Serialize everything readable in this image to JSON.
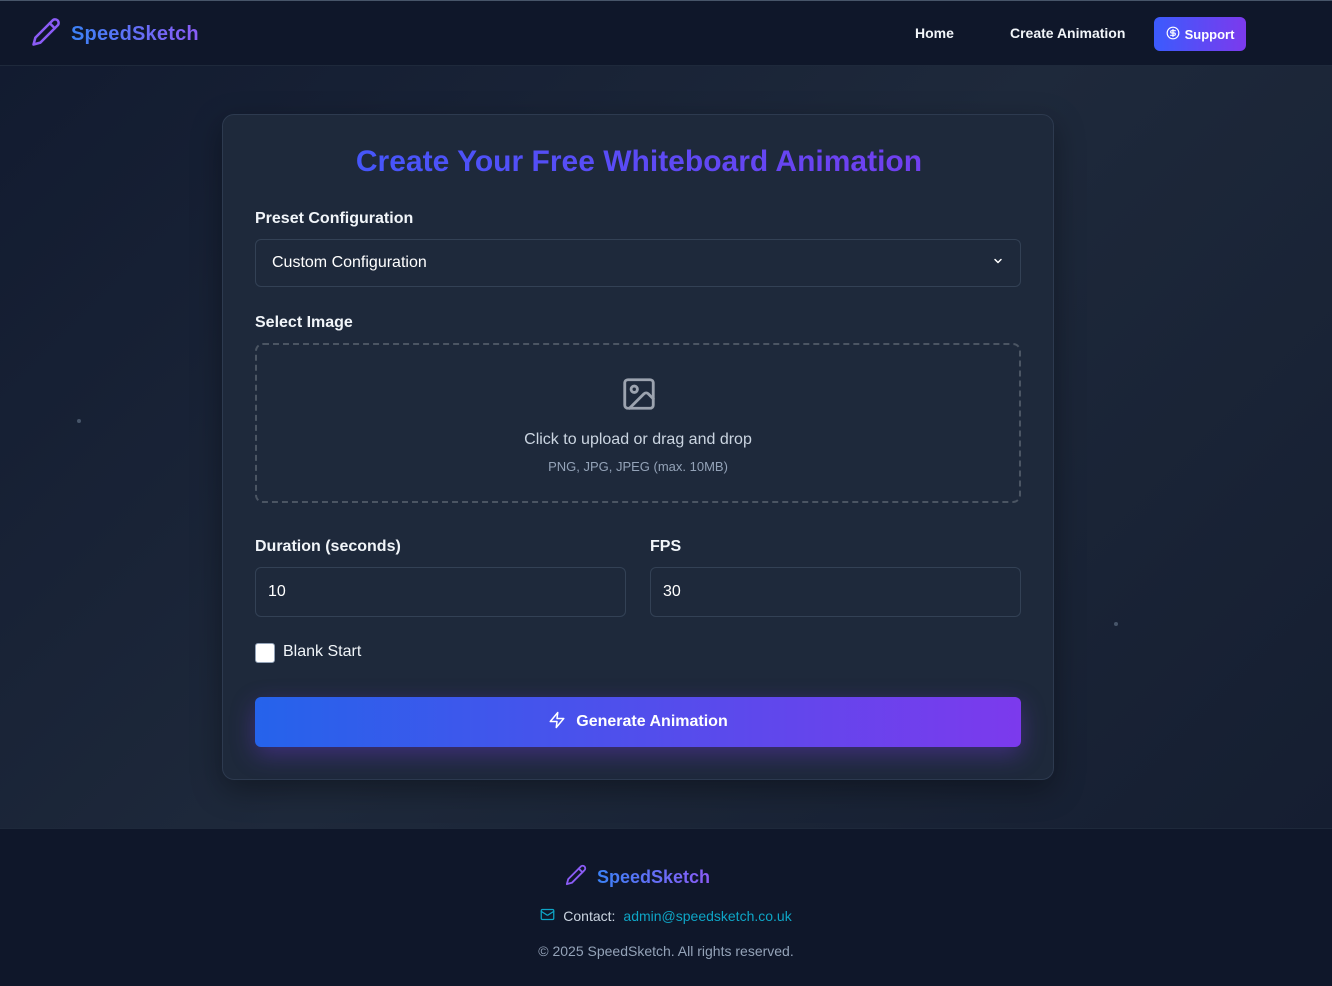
{
  "nav": {
    "brand": "SpeedSketch",
    "home_label": "Home",
    "create_label": "Create Animation",
    "support_label": "Support"
  },
  "form": {
    "title": "Create Your Free Whiteboard Animation",
    "preset_label": "Preset Configuration",
    "preset_selected": "Custom Configuration",
    "image_label": "Select Image",
    "upload_text": "Click to upload or drag and drop",
    "upload_hint": "PNG, JPG, JPEG (max. 10MB)",
    "duration_label": "Duration (seconds)",
    "duration_value": "10",
    "fps_label": "FPS",
    "fps_value": "30",
    "blank_start_label": "Blank Start",
    "blank_start_checked": false,
    "generate_label": "Generate Animation"
  },
  "footer": {
    "brand": "SpeedSketch",
    "contact_prefix": "Contact:",
    "contact_email": "admin@speedsketch.co.uk",
    "copyright": "© 2025 SpeedSketch. All rights reserved."
  },
  "icons": {
    "brand": "pencil-icon",
    "support": "dollar-circle-icon",
    "select": "chevron-down-icon",
    "upload": "image-icon",
    "generate": "lightning-icon",
    "contact": "mail-icon"
  },
  "colors": {
    "accent_start": "#3b5bfd",
    "accent_end": "#7c3aed",
    "background": "#0f172a",
    "card": "#1e293b",
    "link": "#0ea5c6"
  }
}
